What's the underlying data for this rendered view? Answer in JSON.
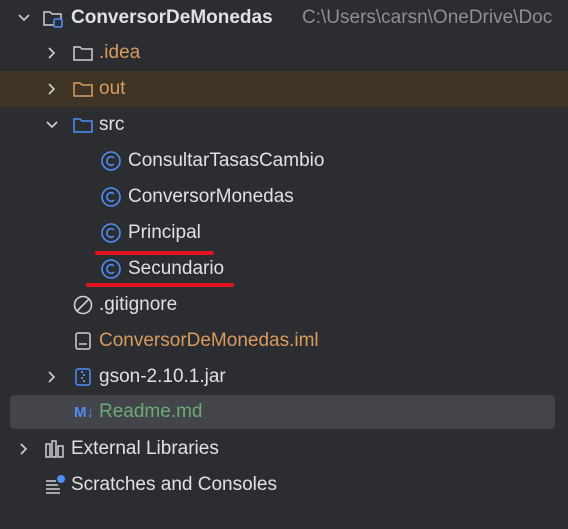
{
  "project": {
    "name": "ConversorDeMonedas",
    "path": "C:\\Users\\carsn\\OneDrive\\Doc"
  },
  "items": [
    {
      "label": "ConversorDeMonedas",
      "icon": "module-folder-icon"
    },
    {
      "label": ".idea",
      "icon": "folder-icon"
    },
    {
      "label": "out",
      "icon": "excluded-folder-icon"
    },
    {
      "label": "src",
      "icon": "source-folder-icon"
    },
    {
      "label": "ConsultarTasasCambio",
      "icon": "java-class-icon"
    },
    {
      "label": "ConversorMonedas",
      "icon": "java-class-icon"
    },
    {
      "label": "Principal",
      "icon": "java-class-icon"
    },
    {
      "label": "Secundario",
      "icon": "java-class-icon"
    },
    {
      "label": ".gitignore",
      "icon": "ignore-file-icon"
    },
    {
      "label": "ConversorDeMonedas.iml",
      "icon": "iml-file-icon"
    },
    {
      "label": "gson-2.10.1.jar",
      "icon": "jar-archive-icon"
    },
    {
      "label": "Readme.md",
      "icon": "markdown-icon"
    },
    {
      "label": "External Libraries",
      "icon": "libraries-icon"
    },
    {
      "label": "Scratches and Consoles",
      "icon": "scratches-icon"
    }
  ],
  "markdown_badge": "M↓",
  "colors": {
    "background": "#2b2d30",
    "text": "#dfe1e5",
    "path": "#8c8f94",
    "excluded_row": "#3d3425",
    "selected_row": "#43454a",
    "orange_text": "#d99b5e",
    "green_text": "#6aab73",
    "class_icon": "#4d8ef7",
    "annotation_underline": "#e0141e"
  }
}
